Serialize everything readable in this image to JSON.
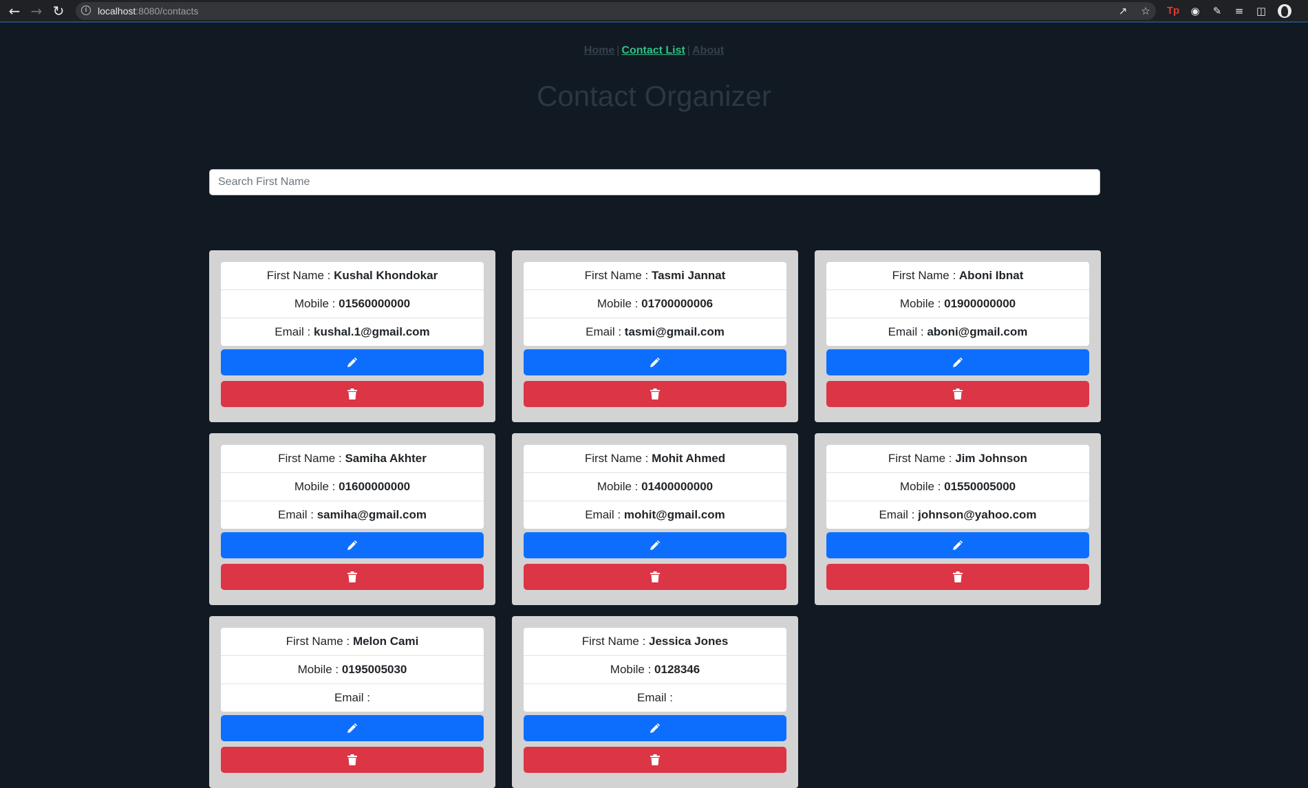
{
  "browser": {
    "url_host": "localhost",
    "url_rest": ":8080/contacts",
    "back_icon": "arrow-left-icon",
    "forward_icon": "arrow-right-icon",
    "reload_icon": "reload-icon",
    "extension_tp_label": "Tp"
  },
  "nav": {
    "home": "Home",
    "contact_list": "Contact List",
    "about": "About",
    "separator": "|"
  },
  "title": "Contact Organizer",
  "search": {
    "placeholder": "Search First Name",
    "value": ""
  },
  "labels": {
    "first_name": "First Name : ",
    "mobile": "Mobile : ",
    "email": "Email : "
  },
  "contacts": [
    {
      "first_name": "Kushal Khondokar",
      "mobile": "01560000000",
      "email": "kushal.1@gmail.com"
    },
    {
      "first_name": "Tasmi Jannat",
      "mobile": "01700000006",
      "email": "tasmi@gmail.com"
    },
    {
      "first_name": "Aboni Ibnat",
      "mobile": "01900000000",
      "email": "aboni@gmail.com"
    },
    {
      "first_name": "Samiha Akhter",
      "mobile": "01600000000",
      "email": "samiha@gmail.com"
    },
    {
      "first_name": "Mohit Ahmed",
      "mobile": "01400000000",
      "email": "mohit@gmail.com"
    },
    {
      "first_name": "Jim Johnson",
      "mobile": "01550005000",
      "email": "johnson@yahoo.com"
    },
    {
      "first_name": "Melon Cami",
      "mobile": "0195005030",
      "email": ""
    },
    {
      "first_name": "Jessica Jones",
      "mobile": "0128346",
      "email": ""
    }
  ],
  "colors": {
    "background": "#111a22",
    "active_link": "#2fc187",
    "edit_button": "#0d6efd",
    "delete_button": "#dc3545",
    "card": "#d3d3d3"
  }
}
